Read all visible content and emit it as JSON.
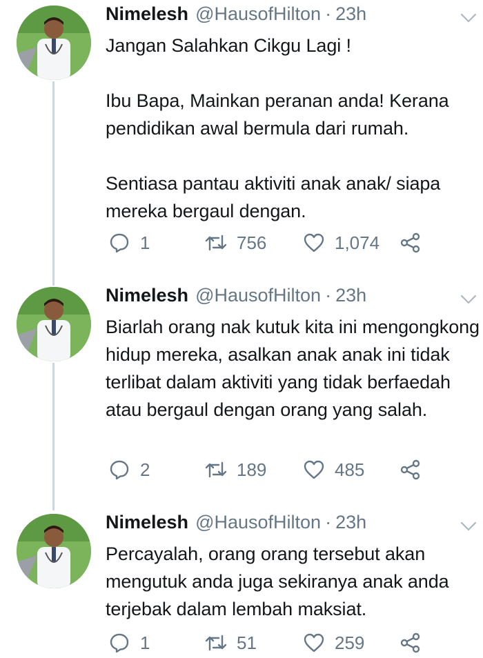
{
  "tweets": [
    {
      "author_name": "Nimelesh",
      "handle": "@HausofHilton",
      "separator": "·",
      "time": "23h",
      "text": "Jangan Salahkan Cikgu Lagi !\n\nIbu Bapa, Mainkan peranan anda! Kerana pendidikan awal bermula dari rumah.\n\nSentiasa pantau aktiviti anak anak/ siapa mereka bergaul dengan.",
      "replies": "1",
      "retweets": "756",
      "likes": "1,074"
    },
    {
      "author_name": "Nimelesh",
      "handle": "@HausofHilton",
      "separator": "·",
      "time": "23h",
      "text": "Biarlah orang nak kutuk kita ini mengongkong hidup mereka, asalkan anak anak ini tidak terlibat dalam aktiviti yang tidak berfaedah atau bergaul dengan orang yang salah.",
      "replies": "2",
      "retweets": "189",
      "likes": "485"
    },
    {
      "author_name": "Nimelesh",
      "handle": "@HausofHilton",
      "separator": "·",
      "time": "23h",
      "text": "Percayalah, orang orang tersebut akan mengutuk anda juga sekiranya anak anda terjebak dalam lembah maksiat.",
      "replies": "1",
      "retweets": "51",
      "likes": "259"
    }
  ],
  "icons": {
    "reply": "reply-icon",
    "retweet": "retweet-icon",
    "like": "like-icon",
    "share": "share-icon",
    "caret": "chevron-down-icon"
  },
  "colors": {
    "text": "#14171a",
    "secondary": "#657786",
    "thread_line": "#ccd6dd"
  }
}
